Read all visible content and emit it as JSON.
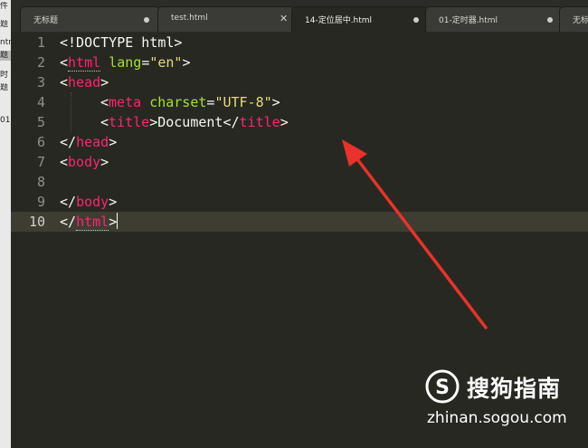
{
  "sidebar": {
    "items": [
      "件",
      "题",
      "ntr",
      "题",
      "时",
      "题",
      "01"
    ]
  },
  "tabs": [
    {
      "label": "无标题",
      "indicator": "dot",
      "active": false
    },
    {
      "label": "test.html",
      "indicator": "close",
      "active": false
    },
    {
      "label": "14-定位居中.html",
      "indicator": "dot",
      "active": true
    },
    {
      "label": "01-定时器.html",
      "indicator": "dot",
      "active": false
    },
    {
      "label": "无标",
      "indicator": "none",
      "active": false
    }
  ],
  "editor": {
    "current_line": 10,
    "line_numbers": [
      "1",
      "2",
      "3",
      "4",
      "5",
      "6",
      "7",
      "8",
      "9",
      "10"
    ],
    "code": {
      "l1": {
        "text": "<!DOCTYPE html>"
      },
      "l2": {
        "open": "<",
        "tag": "html",
        "attr": "lang",
        "eq": "=",
        "val": "\"en\"",
        "close": ">"
      },
      "l3": {
        "open": "<",
        "tag": "head",
        "close": ">"
      },
      "l4": {
        "open": "<",
        "tag": "meta",
        "attr": "charset",
        "eq": "=",
        "val": "\"UTF-8\"",
        "close": ">"
      },
      "l5": {
        "open": "<",
        "tag": "title",
        "mid": ">Document</",
        "tag2": "title",
        "close": ">"
      },
      "l6": {
        "open": "</",
        "tag": "head",
        "close": ">"
      },
      "l7": {
        "open": "<",
        "tag": "body",
        "close": ">"
      },
      "l9": {
        "open": "</",
        "tag": "body",
        "close": ">"
      },
      "l10": {
        "open": "</",
        "tag": "html",
        "close": ">"
      }
    }
  },
  "watermark": {
    "brand": "搜狗指南",
    "url": "zhinan.sogou.com",
    "logo_letter": "S"
  },
  "colors": {
    "background": "#272822",
    "tag": "#f92672",
    "attribute": "#a6e22e",
    "string": "#e6db74",
    "text": "#f8f8f2",
    "arrow": "#e8322b"
  }
}
